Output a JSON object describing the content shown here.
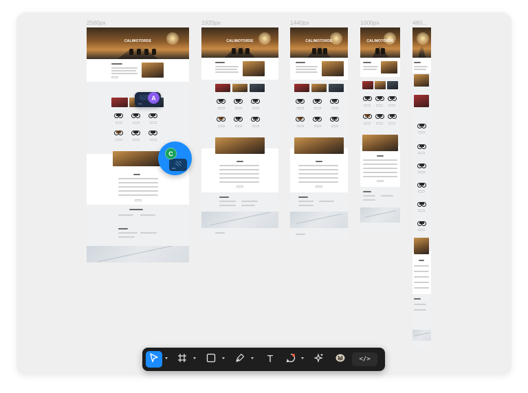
{
  "canvas": {
    "frames": [
      {
        "id": "f2560",
        "label": "2560px",
        "hero_title": "CALIMOTORDE"
      },
      {
        "id": "f1920",
        "label": "1920px",
        "hero_title": "CALIMOTORDE"
      },
      {
        "id": "f1440",
        "label": "1440px",
        "hero_title": "CALIMOTORDE"
      },
      {
        "id": "f1000",
        "label": "1000px",
        "hero_title": "CALIMOTORDE"
      },
      {
        "id": "f480",
        "label": "480..."
      }
    ],
    "collaborators": [
      {
        "initial": "A",
        "color": "#8a5cf0"
      },
      {
        "initial": "C",
        "color": "#17a35c"
      }
    ]
  },
  "toolbar": {
    "tools": [
      {
        "icon": "pointer-icon",
        "active": true
      },
      {
        "icon": "frame-icon"
      },
      {
        "icon": "rectangle-icon"
      },
      {
        "icon": "pen-icon"
      },
      {
        "icon": "text-icon",
        "glyph": "T"
      },
      {
        "icon": "comment-icon"
      },
      {
        "icon": "ai-sparkle-icon"
      },
      {
        "icon": "plugin-icon"
      }
    ],
    "dev_mode": {
      "glyph": "</>"
    },
    "colors": {
      "background": "#1e1e1e",
      "active": "#1a8cff"
    }
  }
}
